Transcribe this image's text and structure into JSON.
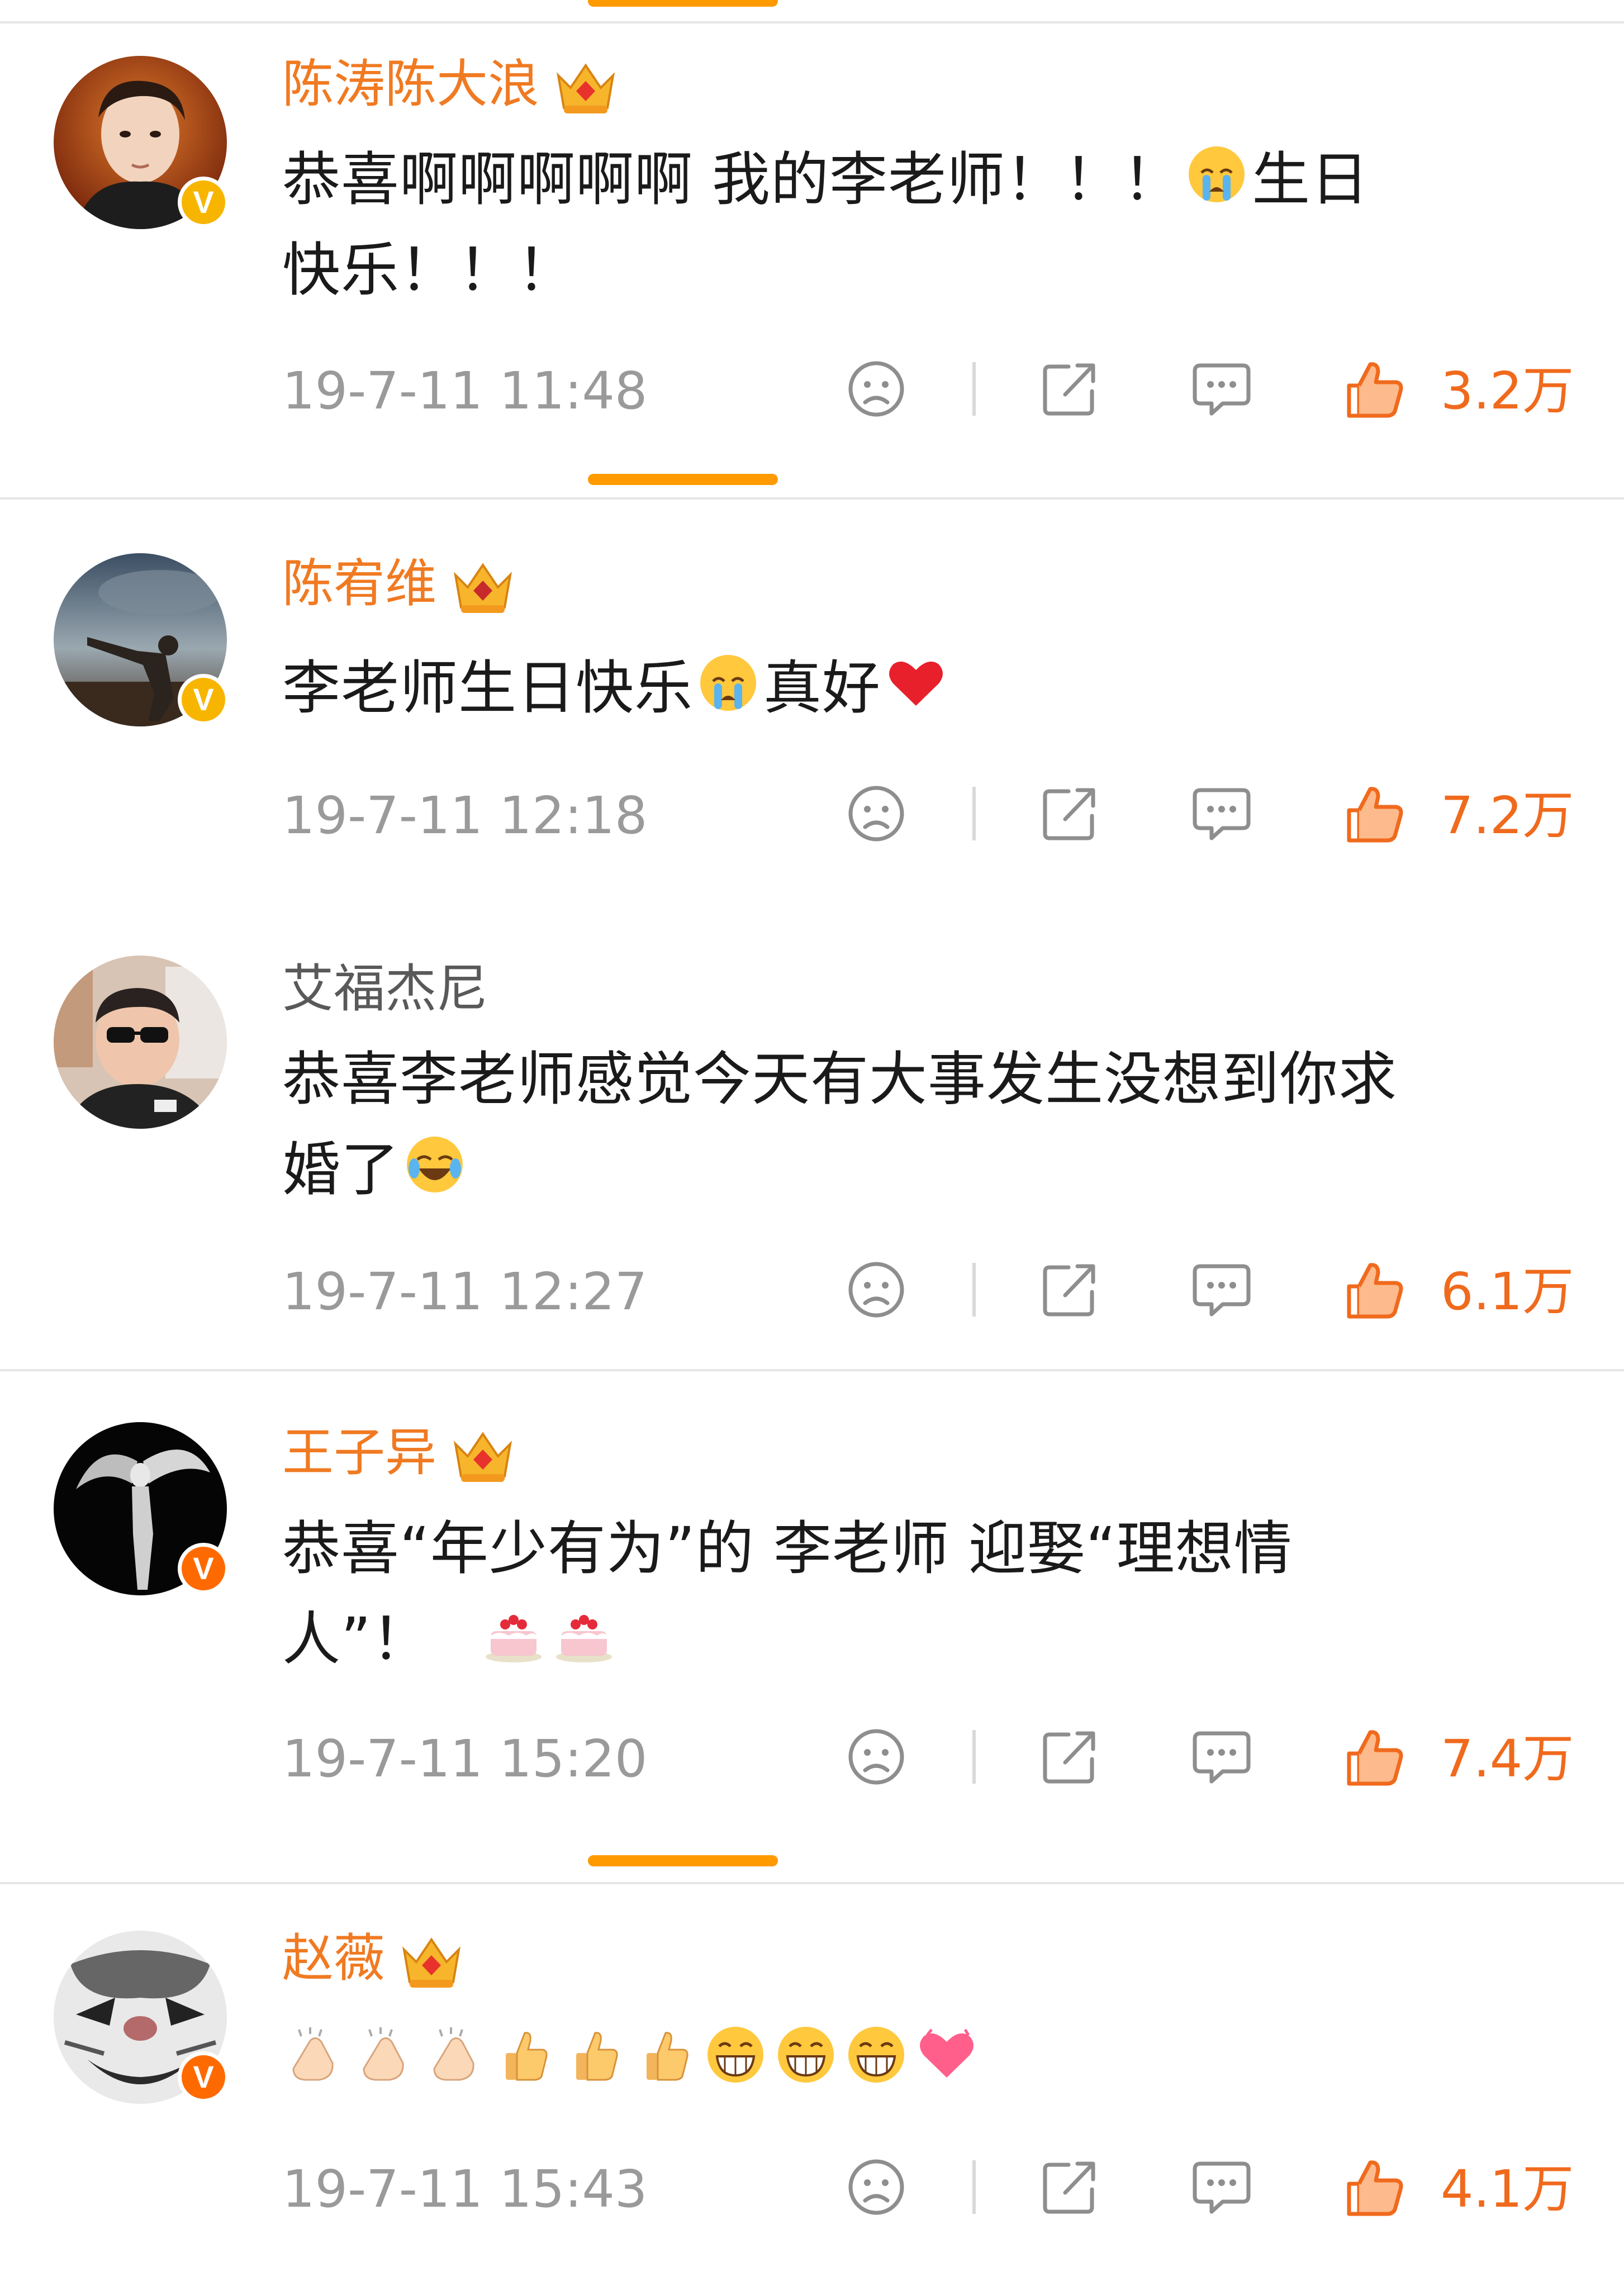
{
  "comments": [
    {
      "name": "陈涛陈大浪",
      "verified": true,
      "line1": "恭喜啊啊啊啊啊 我的李老师！！！",
      "line1_tail": "生日",
      "line2": "快乐！！！",
      "time": "19-7-11 11:48",
      "likes": "3.2万"
    },
    {
      "name": "陈宥维",
      "verified": true,
      "line1": "李老师生日快乐",
      "line1_tail": "真好",
      "time": "19-7-11 12:18",
      "likes": "7.2万"
    },
    {
      "name": "艾福杰尼",
      "verified": false,
      "line1": "恭喜李老师感觉今天有大事发生没想到你求",
      "line2": "婚了",
      "time": "19-7-11 12:27",
      "likes": "6.1万"
    },
    {
      "name": "王子异",
      "verified": true,
      "line1": "恭喜“年少有为”的 李老师 迎娶“理想情",
      "line2": "人”！",
      "time": "19-7-11 15:20",
      "likes": "7.4万"
    },
    {
      "name": "赵薇",
      "verified": true,
      "time": "19-7-11 15:43",
      "likes": "4.1万"
    }
  ],
  "badge_letter": "V",
  "icons": [
    "sad-face-icon",
    "share-icon",
    "comment-icon",
    "thumbs-up-icon",
    "crown-icon",
    "crying-emoji",
    "laughing-emoji",
    "cake-emoji",
    "clap-emoji",
    "grin-emoji",
    "heart-emoji"
  ],
  "colors": {
    "accent": "#f07a22",
    "likes": "#f06a1d",
    "time": "#9a9a9a",
    "bar": "#ff9a00",
    "badge": "#f8b500"
  }
}
